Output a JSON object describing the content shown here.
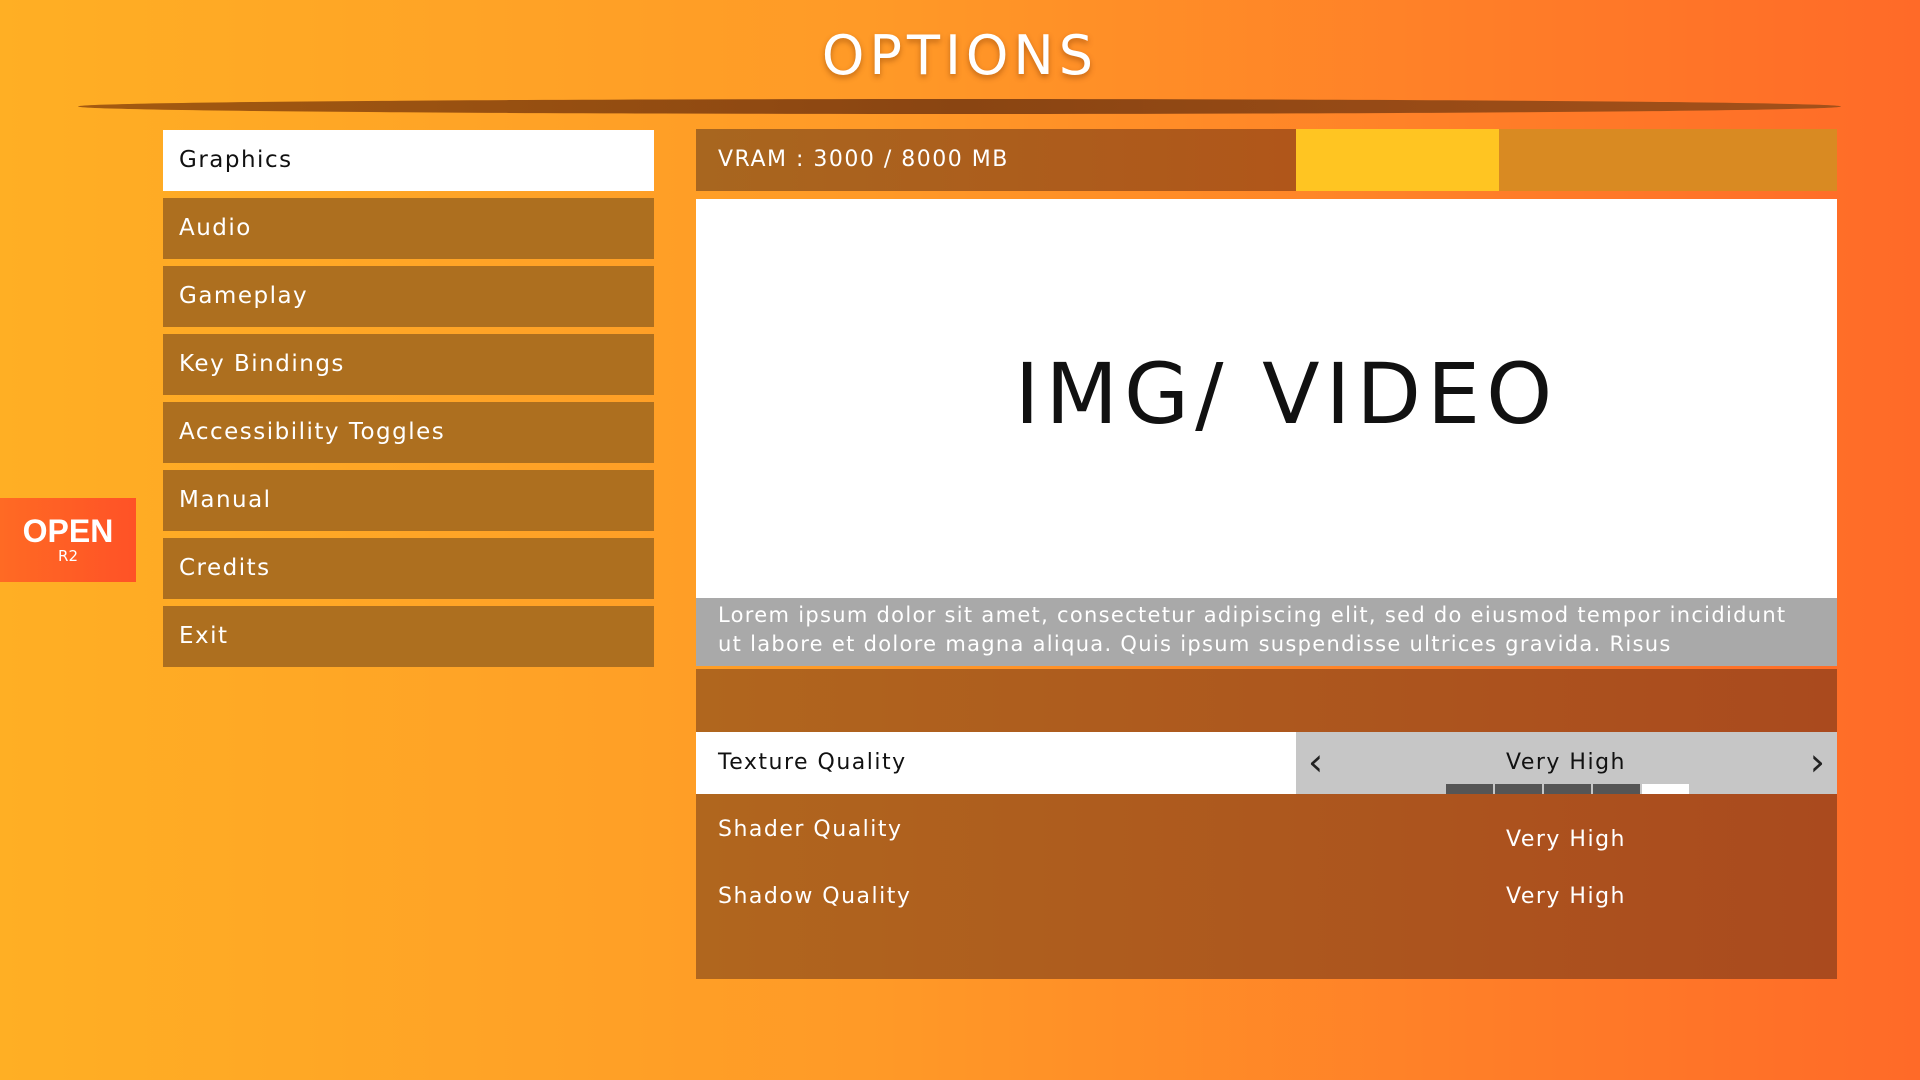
{
  "title": "OPTIONS",
  "menu": {
    "items": [
      {
        "label": "Graphics",
        "active": true
      },
      {
        "label": "Audio"
      },
      {
        "label": "Gameplay"
      },
      {
        "label": "Key Bindings"
      },
      {
        "label": "Accessibility Toggles"
      },
      {
        "label": "Manual"
      },
      {
        "label": "Credits"
      },
      {
        "label": "Exit"
      }
    ]
  },
  "open_tab": {
    "label": "OPEN",
    "shortcut": "R2"
  },
  "vram": {
    "label": "VRAM : 3000 / 8000 MB",
    "used_mb": 3000,
    "total_mb": 8000
  },
  "preview": {
    "placeholder": "IMG/ VIDEO"
  },
  "description": "Lorem ipsum dolor sit amet, consectetur adipiscing elit, sed do eiusmod tempor incididunt ut labore et dolore magna aliqua. Quis ipsum suspendisse ultrices gravida. Risus",
  "settings": [
    {
      "label": "Texture Quality",
      "value": "Very High",
      "level": 5,
      "max_level": 5,
      "selected": true
    },
    {
      "label": "Shader Quality",
      "value": "Very High"
    },
    {
      "label": "Shadow Quality",
      "value": "Very High"
    }
  ],
  "icons": {
    "prev": "chevron-left-icon",
    "next": "chevron-right-icon"
  },
  "colors": {
    "accent": "#ffc522",
    "panel": "#ad6f1f",
    "open_tab": "#ff5a26"
  }
}
